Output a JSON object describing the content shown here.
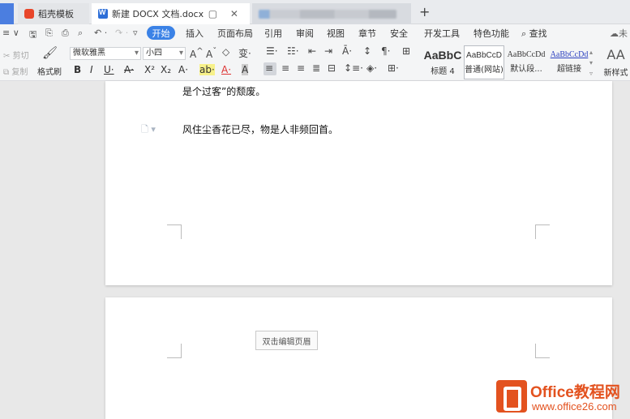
{
  "tabs": {
    "tab1": "稻壳模板",
    "tab2": "新建 DOCX 文档.docx",
    "tab2_controls": "▢ ✕",
    "add": "+"
  },
  "menu": {
    "start": "开始",
    "items": [
      "插入",
      "页面布局",
      "引用",
      "审阅",
      "视图",
      "章节",
      "安全",
      "开发工具",
      "特色功能"
    ],
    "search": "查找",
    "cloud": "未"
  },
  "toolbar": {
    "cut": "剪切",
    "copy": "复制",
    "format_painter": "格式刷",
    "font": "微软雅黑",
    "size": "小四",
    "styles": [
      {
        "sample": "AaBbC",
        "label": "标题 4"
      },
      {
        "sample": "AaBbCcD",
        "label": "普通(网站)"
      },
      {
        "sample": "AaBbCcDd",
        "label": "默认段..."
      },
      {
        "sample": "AaBbCcDd",
        "label": "超链接"
      }
    ],
    "new_style": "新样式",
    "new_style_icon": "AA"
  },
  "document": {
    "line1": "是个过客”的颓废。",
    "line2": "风住尘香花已尽，物是人非频回首。",
    "header_tip": "双击编辑页眉"
  },
  "watermark": {
    "title": "Office教程网",
    "url": "www.office26.com"
  }
}
